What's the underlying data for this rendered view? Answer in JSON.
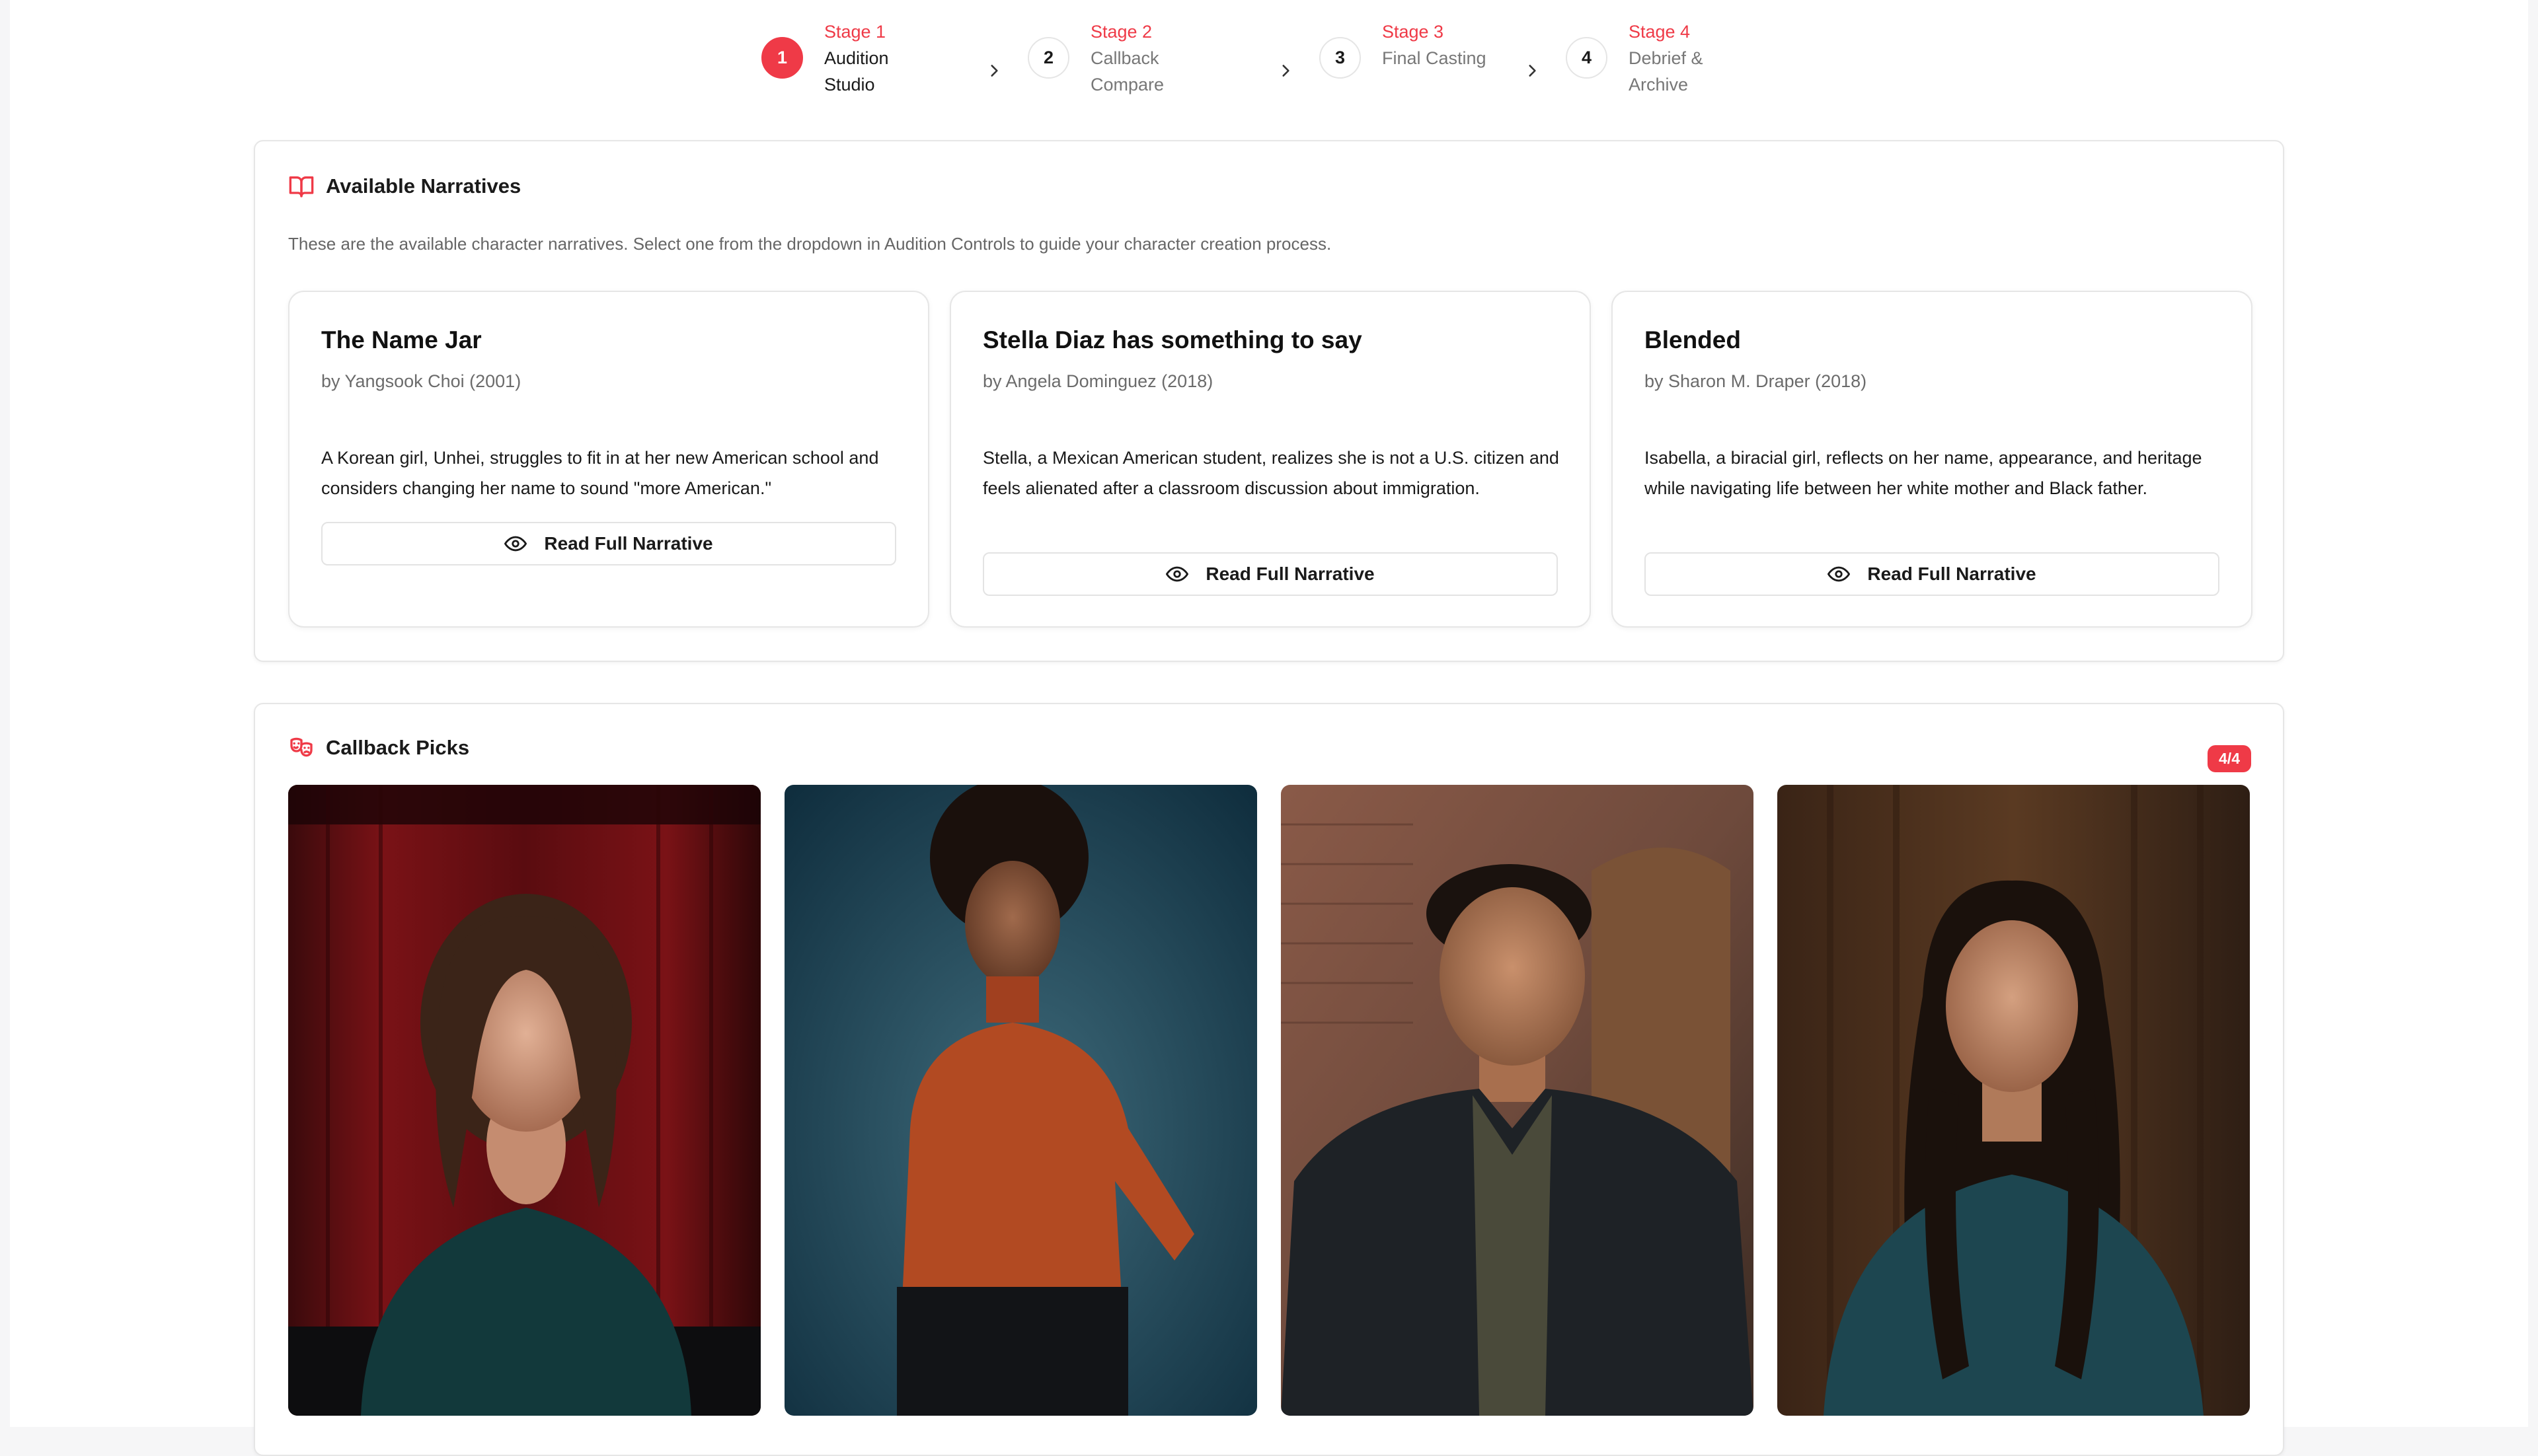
{
  "stepper": [
    {
      "number": "1",
      "stage": "Stage 1",
      "name": "Audition Studio",
      "active": true
    },
    {
      "number": "2",
      "stage": "Stage 2",
      "name": "Callback Compare",
      "active": false
    },
    {
      "number": "3",
      "stage": "Stage 3",
      "name": "Final Casting",
      "active": false
    },
    {
      "number": "4",
      "stage": "Stage 4",
      "name": "Debrief & Archive",
      "active": false
    }
  ],
  "narratives": {
    "title": "Available Narratives",
    "description": "These are the available character narratives. Select one from the dropdown in Audition Controls to guide your character creation process.",
    "icon": "book-open-icon",
    "cards": [
      {
        "title": "The Name Jar",
        "author": "by Yangsook Choi (2001)",
        "summary": "A Korean girl, Unhei, struggles to fit in at her new American school and considers changing her name to sound \"more American.\"",
        "button": "Read Full Narrative"
      },
      {
        "title": "Stella Diaz has something to say",
        "author": "by Angela Dominguez (2018)",
        "summary": "Stella, a Mexican American student, realizes she is not a U.S. citizen and feels alienated after a classroom discussion about immigration.",
        "button": "Read Full Narrative"
      },
      {
        "title": "Blended",
        "author": "by Sharon M. Draper (2018)",
        "summary": "Isabella, a biracial girl, reflects on her name, appearance, and heritage while navigating life between her white mother and Black father.",
        "button": "Read Full Narrative"
      }
    ]
  },
  "callback": {
    "title": "Callback Picks",
    "icon": "theater-masks-icon",
    "count": "4/4",
    "photos": [
      {
        "name": "callback-photo-1"
      },
      {
        "name": "callback-photo-2"
      },
      {
        "name": "callback-photo-3"
      },
      {
        "name": "callback-photo-4"
      }
    ]
  },
  "colors": {
    "accent": "#ef3a47",
    "border": "#e6e6e6",
    "muted_text": "#6b6b6b"
  }
}
